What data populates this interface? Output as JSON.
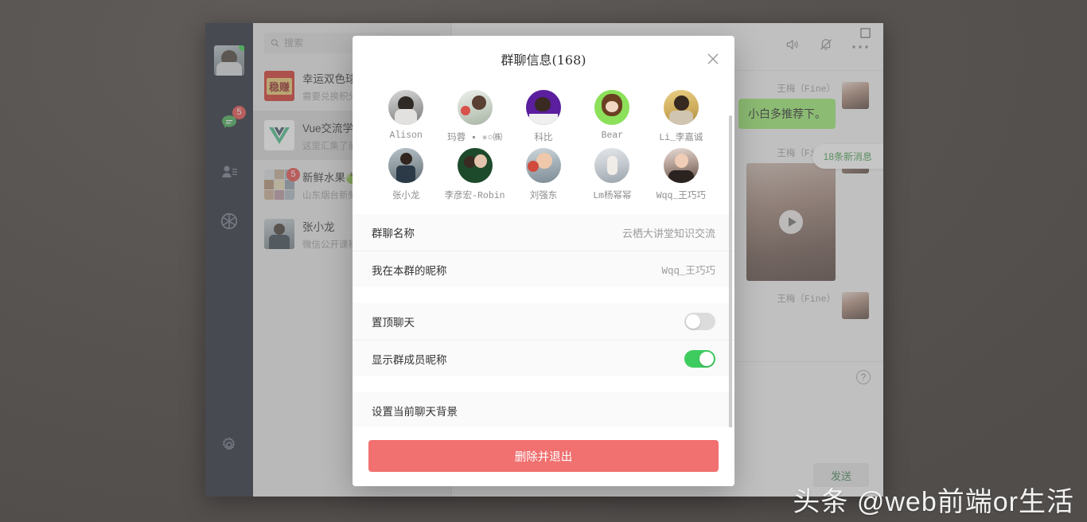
{
  "desktop": {
    "background_color": "#5a5654"
  },
  "watermark": {
    "text": "头条 @web前端or生活"
  },
  "window": {
    "controls": {
      "maximize_label": "□",
      "more_label": "•••"
    },
    "header_icons": {
      "speaker": "speaker-icon",
      "bell": "bell-muted-icon",
      "more": "more-icon"
    }
  },
  "sidebar": {
    "self_avatar_label": "self-avatar",
    "items": [
      {
        "name": "chat",
        "icon": "chat-icon",
        "badge": "5",
        "active": true
      },
      {
        "name": "contacts",
        "icon": "contacts-icon",
        "badge": "",
        "active": false
      },
      {
        "name": "discover",
        "icon": "discover-icon",
        "badge": "",
        "active": false
      }
    ],
    "settings_icon": "gear-icon"
  },
  "search": {
    "placeholder": "搜索",
    "value": "",
    "icon": "search-icon"
  },
  "chat_list": [
    {
      "title": "幸运双色球",
      "snippet": "需要兑换积分",
      "badge": "",
      "thumb": "lottery",
      "active": false
    },
    {
      "title": "Vue交流学",
      "snippet": "这里汇集了前",
      "badge": "",
      "thumb": "vue",
      "active": true
    },
    {
      "title": "新鲜水果🍏",
      "snippet": "山东烟台新鲜",
      "badge": "5",
      "thumb": "grid",
      "active": false
    },
    {
      "title": "张小龙",
      "snippet": "微信公开课程",
      "badge": "",
      "thumb": "person",
      "active": false
    }
  ],
  "conversation": {
    "messages": [
      {
        "sender": "王梅（Fine）",
        "type": "text",
        "text": "小白多推荐下。"
      },
      {
        "sender": "王梅（Fine）",
        "type": "media"
      },
      {
        "sender": "王梅（Fine）",
        "type": "text",
        "text": ""
      }
    ],
    "new_message_pill": "18条新消息",
    "help_icon": "question-icon",
    "send_label": "发送"
  },
  "modal": {
    "title": "群聊信息(168)",
    "close_label": "×",
    "members": [
      {
        "name": "Alison",
        "avatar": "av-alison"
      },
      {
        "name": "玛蓉 ▪ ✳○㈱",
        "avatar": "av-marong"
      },
      {
        "name": "科比",
        "avatar": "av-kobe"
      },
      {
        "name": "Bear",
        "avatar": "av-bear"
      },
      {
        "name": "Li_李嘉诚",
        "avatar": "av-li"
      },
      {
        "name": "张小龙",
        "avatar": "av-zhang"
      },
      {
        "name": "李彦宏-Robin",
        "avatar": "av-robin"
      },
      {
        "name": "刘强东",
        "avatar": "av-liu"
      },
      {
        "name": "Lm杨幂幂",
        "avatar": "av-lm"
      },
      {
        "name": "Wqq_王巧巧",
        "avatar": "av-wqq"
      }
    ],
    "info_rows": [
      {
        "label": "群聊名称",
        "value": "云栖大讲堂知识交流"
      },
      {
        "label": "我在本群的昵称",
        "value": "Wqq_王巧巧"
      }
    ],
    "toggle_rows": [
      {
        "label": "置顶聊天",
        "on": false
      },
      {
        "label": "显示群成员昵称",
        "on": true
      }
    ],
    "action_rows": [
      {
        "label": "设置当前聊天背景"
      }
    ],
    "danger_button": "删除并退出",
    "accent_colors": {
      "toggle_on": "#3ecc5f",
      "danger": "#f17070"
    }
  }
}
